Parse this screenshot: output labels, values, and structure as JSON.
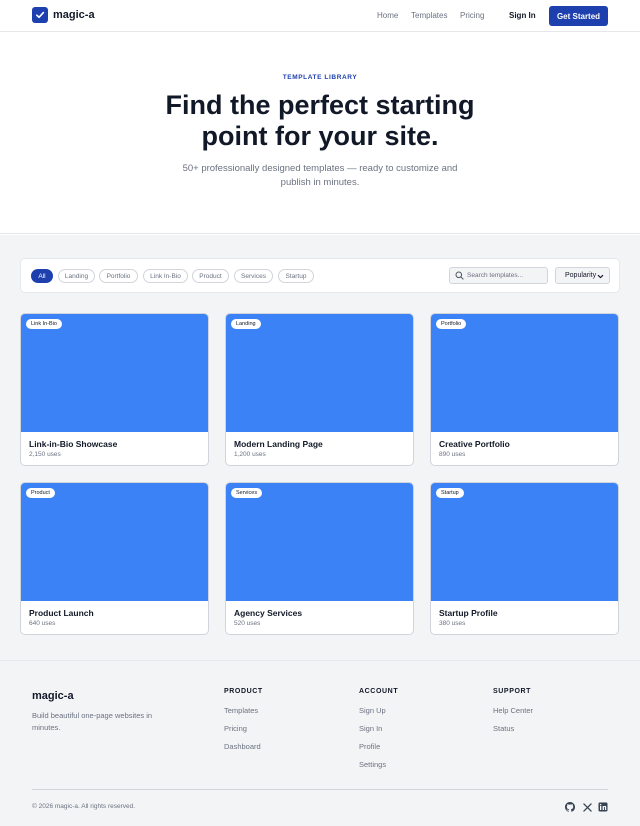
{
  "nav": {
    "brand": "magic-a",
    "links": [
      "Home",
      "Templates",
      "Pricing"
    ],
    "sign_in": "Sign In",
    "cta": "Get Started"
  },
  "hero": {
    "eyebrow": "TEMPLATE LIBRARY",
    "title": "Find the perfect starting point for your site.",
    "subtitle": "50+ professionally designed templates — ready to customize and publish in minutes."
  },
  "filters": {
    "pills": [
      "All",
      "Landing",
      "Portfolio",
      "Link In-Bio",
      "Product",
      "Services",
      "Startup"
    ],
    "active": "All",
    "search_placeholder": "Search templates...",
    "sort_selected": "Popularity"
  },
  "templates": [
    {
      "badge": "Link In-Bio",
      "title": "Link-in-Bio Showcase",
      "uses": "2,150 uses"
    },
    {
      "badge": "Landing",
      "title": "Modern Landing Page",
      "uses": "1,200 uses"
    },
    {
      "badge": "Portfolio",
      "title": "Creative Portfolio",
      "uses": "890 uses"
    },
    {
      "badge": "Product",
      "title": "Product Launch",
      "uses": "640 uses"
    },
    {
      "badge": "Services",
      "title": "Agency Services",
      "uses": "520 uses"
    },
    {
      "badge": "Startup",
      "title": "Startup Profile",
      "uses": "380 uses"
    }
  ],
  "footer": {
    "brand": "magic-a",
    "tagline": "Build beautiful one-page websites in minutes.",
    "columns": [
      {
        "heading": "PRODUCT",
        "links": [
          "Templates",
          "Pricing",
          "Dashboard"
        ]
      },
      {
        "heading": "ACCOUNT",
        "links": [
          "Sign Up",
          "Sign In",
          "Profile",
          "Settings"
        ]
      },
      {
        "heading": "SUPPORT",
        "links": [
          "Help Center",
          "Status"
        ]
      }
    ],
    "copyright": "© 2026 magic-a. All rights reserved.",
    "social_icons": [
      "github-icon",
      "x-icon",
      "linkedin-icon"
    ]
  },
  "colors": {
    "brand": "#1e40af",
    "card_image": "#3b82f6",
    "background_muted": "#f3f4f6",
    "text_primary": "#111827",
    "text_secondary": "#6b7280"
  }
}
